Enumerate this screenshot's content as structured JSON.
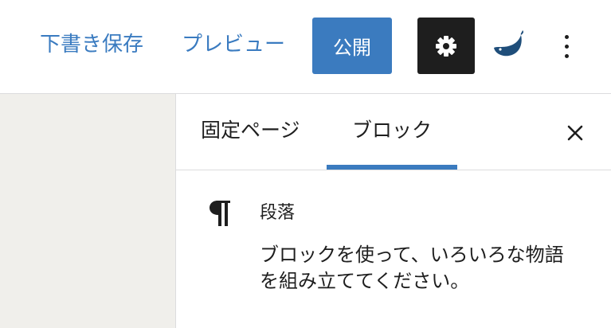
{
  "header": {
    "save_draft_label": "下書き保存",
    "preview_label": "プレビュー",
    "publish_label": "公開",
    "settings_icon": "gear-icon",
    "plugin_icon": "whale-icon",
    "more_icon": "more-vertical-icon"
  },
  "sidebar": {
    "tabs": [
      {
        "label": "固定ページ",
        "active": false
      },
      {
        "label": "ブロック",
        "active": true
      }
    ],
    "close_icon": "close-icon",
    "block": {
      "icon": "paragraph-icon",
      "title": "段落",
      "description_line1": "ブロックを使って、いろいろな物語",
      "description_line2": "を組み立ててください。"
    }
  },
  "colors": {
    "accent": "#3b7bbf",
    "link": "#3a7bc0",
    "dark": "#1e1e1e",
    "canvas": "#f0efeb"
  }
}
